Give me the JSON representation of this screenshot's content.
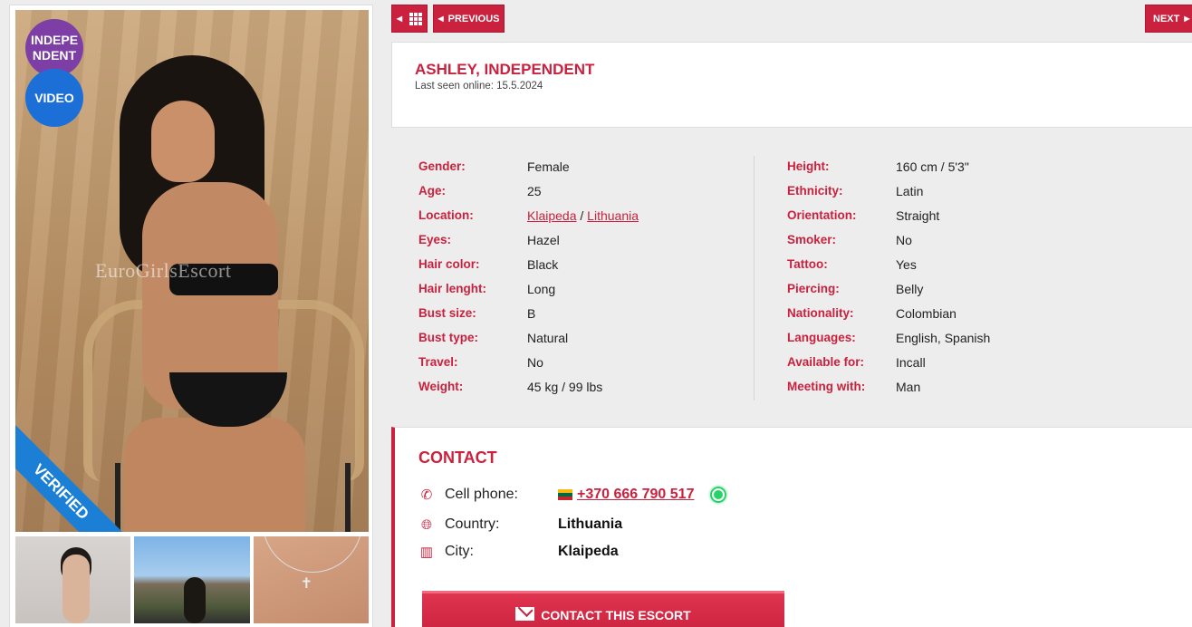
{
  "badges": {
    "independent": "INDEPE NDENT",
    "video": "VIDEO",
    "verified": "VERIFIED"
  },
  "watermark": "EuroGirlsEscort",
  "nav": {
    "previous": "PREVIOUS",
    "next": "NEXT"
  },
  "profile": {
    "name": "ASHLEY, INDEPENDENT",
    "last_seen": "Last seen online: 15.5.2024"
  },
  "details_left": [
    {
      "label": "Gender:",
      "value": "Female"
    },
    {
      "label": "Age:",
      "value": "25"
    },
    {
      "label": "Location:",
      "value": "",
      "link1": "Klaipeda",
      "sep": " / ",
      "link2": "Lithuania"
    },
    {
      "label": "Eyes:",
      "value": "Hazel"
    },
    {
      "label": "Hair color:",
      "value": "Black"
    },
    {
      "label": "Hair lenght:",
      "value": "Long"
    },
    {
      "label": "Bust size:",
      "value": "B"
    },
    {
      "label": "Bust type:",
      "value": "Natural"
    },
    {
      "label": "Travel:",
      "value": "No"
    },
    {
      "label": "Weight:",
      "value": "45 kg / 99 lbs"
    }
  ],
  "details_right": [
    {
      "label": "Height:",
      "value": "160 cm / 5'3\""
    },
    {
      "label": "Ethnicity:",
      "value": "Latin"
    },
    {
      "label": "Orientation:",
      "value": "Straight"
    },
    {
      "label": "Smoker:",
      "value": "No"
    },
    {
      "label": "Tattoo:",
      "value": "Yes"
    },
    {
      "label": "Piercing:",
      "value": "Belly"
    },
    {
      "label": "Nationality:",
      "value": "Colombian"
    },
    {
      "label": "Languages:",
      "value": "English, Spanish"
    },
    {
      "label": "Available for:",
      "value": "Incall"
    },
    {
      "label": "Meeting with:",
      "value": "Man"
    }
  ],
  "contact": {
    "title": "CONTACT",
    "phone_label": "Cell phone:",
    "phone": "+370 666 790 517",
    "country_label": "Country:",
    "country": "Lithuania",
    "city_label": "City:",
    "city": "Klaipeda",
    "button": "CONTACT THIS ESCORT"
  },
  "colors": {
    "accent": "#c9213e",
    "independent_badge": "#7d3fa6",
    "video_badge": "#1d6fd8",
    "verified_ribbon": "#1c7fd6",
    "whatsapp": "#25d366"
  },
  "icons": [
    "grid-icon",
    "chevron-left-icon",
    "chevron-right-icon",
    "phone-icon",
    "globe-icon",
    "city-icon",
    "whatsapp-icon",
    "envelope-icon",
    "lithuania-flag-icon"
  ]
}
